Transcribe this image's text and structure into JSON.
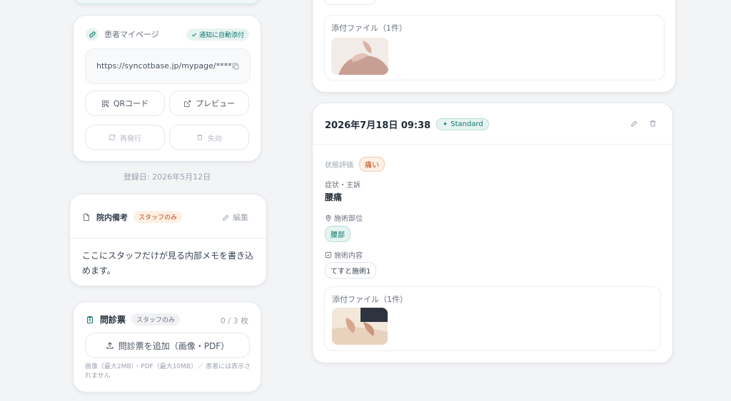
{
  "mypage": {
    "title": "患者マイページ",
    "auto_badge": "通知に自動添付",
    "url": "https://syncotbase.jp/mypage/****",
    "qr_label": "QRコード",
    "preview_label": "プレビュー",
    "reissue_label": "再発行",
    "invalidate_label": "失効"
  },
  "registered": "登録日: 2026年5月12日",
  "memo": {
    "title": "院内備考",
    "badge": "スタッフのみ",
    "edit_label": "編集",
    "body": "ここにスタッフだけが見る内部メモを書き込めます。"
  },
  "questionnaire": {
    "title": "問診票",
    "badge": "スタッフのみ",
    "count": "0 / 3 枚",
    "add_label": "問診票を追加（画像・PDF）",
    "note": "画像（最大2MB）・PDF（最大10MB）／ 患者には表示されません"
  },
  "record_top": {
    "attach_title": "添付ファイル（1件）"
  },
  "record": {
    "datetime": "2026年7月18日 09:38",
    "plan_badge": "Standard",
    "status_label": "状態評価",
    "status_value": "痛い",
    "symptom_label": "症状・主訴",
    "symptom_value": "腰痛",
    "site_label": "施術部位",
    "site_value": "腰部",
    "content_label": "施術内容",
    "content_value": "てすと施術1",
    "attach_title": "添付ファイル（1件）"
  },
  "colors": {
    "accent_teal": "#0f766e",
    "teal_bg": "#e6f4f1",
    "orange_text": "#c2410c",
    "orange_bg": "#fdf1e6"
  }
}
